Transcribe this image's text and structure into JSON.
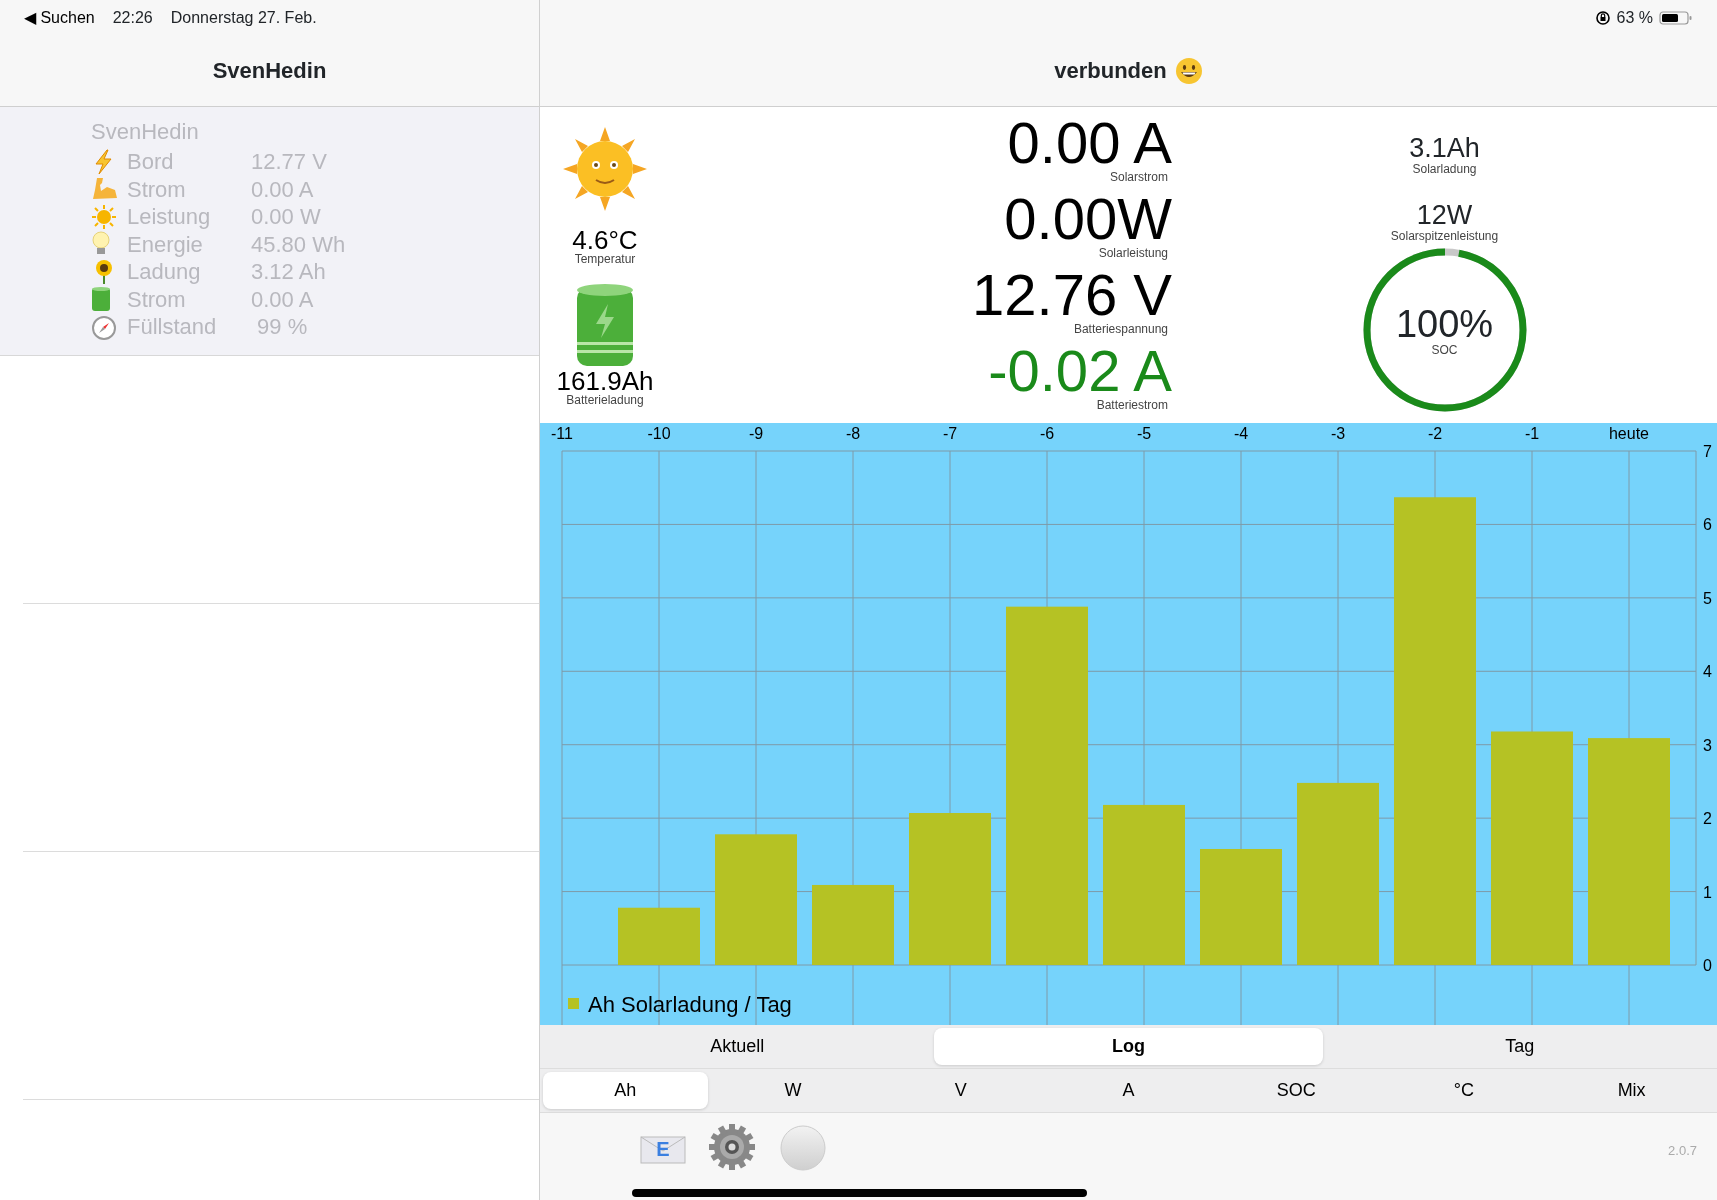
{
  "status_bar": {
    "back": "◀ Suchen",
    "time": "22:26",
    "date": "Donnerstag 27. Feb.",
    "battery": "63 %"
  },
  "sidebar": {
    "title": "SvenHedin",
    "header": "SvenHedin",
    "items": [
      {
        "label": "Bord",
        "value": "12.77 V"
      },
      {
        "label": "Strom",
        "value": "0.00 A"
      },
      {
        "label": "Leistung",
        "value": "0.00 W"
      },
      {
        "label": "Energie",
        "value": "45.80 Wh"
      },
      {
        "label": "Ladung",
        "value": "3.12 Ah"
      },
      {
        "label": "Strom",
        "value": "0.00 A"
      },
      {
        "label": "Füllstand",
        "value": " 99 %"
      }
    ]
  },
  "main": {
    "title": "verbunden",
    "temperature": {
      "value": "4.6°C",
      "label": "Temperatur"
    },
    "battery_charge": {
      "value": "161.9Ah",
      "label": "Batterieladung"
    },
    "readings": [
      {
        "value": "0.00 A",
        "label": "Solarstrom",
        "positive": true
      },
      {
        "value": "0.00W",
        "label": "Solarleistung",
        "positive": true
      },
      {
        "value": "12.76 V",
        "label": "Batteriespannung",
        "positive": true
      },
      {
        "value": "-0.02 A",
        "label": "Batteriestrom",
        "positive": false
      }
    ],
    "solar_charge": {
      "value": "3.1Ah",
      "label": "Solarladung"
    },
    "peak_power": {
      "value": "12W",
      "label": "Solarspitzenleistung"
    },
    "soc": {
      "value": "100%",
      "label": "SOC",
      "level": 0.97
    },
    "chart_data": {
      "type": "bar",
      "grid": true,
      "categories": [
        "-11",
        "-10",
        "-9",
        "-8",
        "-7",
        "-6",
        "-5",
        "-4",
        "-3",
        "-2",
        "-1",
        "heute"
      ],
      "yticks": [
        0,
        1,
        2,
        3,
        4,
        5,
        6,
        7
      ],
      "ylim": [
        0,
        7
      ],
      "series": [
        {
          "name": "Ah Solarladung / Tag",
          "color": "#b5c224",
          "values": [
            null,
            0.78,
            1.78,
            1.09,
            2.07,
            4.88,
            2.18,
            1.58,
            2.48,
            6.37,
            3.18,
            3.09
          ]
        }
      ]
    },
    "tabs": [
      {
        "label": "Aktuell",
        "selected": false
      },
      {
        "label": "Log",
        "selected": true
      },
      {
        "label": "Tag",
        "selected": false
      }
    ],
    "units": [
      {
        "label": "Ah",
        "selected": true
      },
      {
        "label": "W",
        "selected": false
      },
      {
        "label": "V",
        "selected": false
      },
      {
        "label": "A",
        "selected": false
      },
      {
        "label": "SOC",
        "selected": false
      },
      {
        "label": "°C",
        "selected": false
      },
      {
        "label": "Mix",
        "selected": false
      }
    ],
    "mail_button": {
      "label": "E"
    },
    "version": "2.0.7"
  }
}
